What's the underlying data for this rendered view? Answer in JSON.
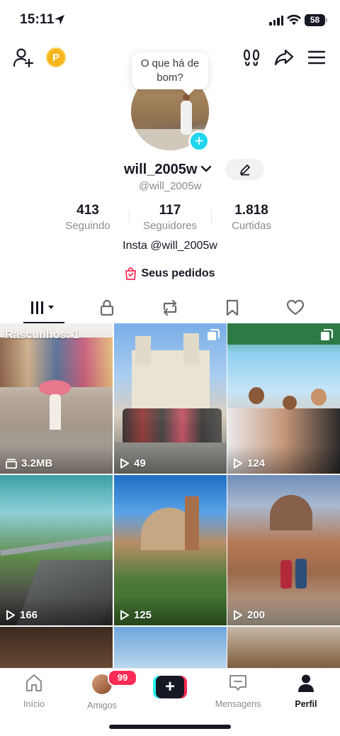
{
  "status_bar": {
    "time": "15:11",
    "battery": "58"
  },
  "profile": {
    "tooltip": "O que há de bom?",
    "username": "will_2005w",
    "handle": "@will_2005w",
    "bio": "Insta @will_2005w",
    "orders_label": "Seus pedidos",
    "coin_letter": "P"
  },
  "stats": [
    {
      "value": "413",
      "label": "Seguindo"
    },
    {
      "value": "117",
      "label": "Seguidores"
    },
    {
      "value": "1.818",
      "label": "Curtidas"
    }
  ],
  "tabs": [
    "videos-tab",
    "private-tab",
    "reposts-tab",
    "saved-tab",
    "liked-tab"
  ],
  "grid": {
    "draft_label": "Rascunhos: 1",
    "tiles": [
      {
        "count": "3.2MB",
        "kind": "draft"
      },
      {
        "count": "49",
        "kind": "video",
        "multi": true
      },
      {
        "count": "124",
        "kind": "video",
        "multi": true
      },
      {
        "count": "166",
        "kind": "video"
      },
      {
        "count": "125",
        "kind": "video"
      },
      {
        "count": "200",
        "kind": "video"
      }
    ]
  },
  "bottom_nav": {
    "items": [
      {
        "label": "Início"
      },
      {
        "label": "Amigos"
      },
      {
        "label": "+"
      },
      {
        "label": "Mensagens"
      },
      {
        "label": "Perfil"
      }
    ],
    "friends_badge": "99"
  },
  "colors": {
    "accent_red": "#fe2c55",
    "accent_cyan": "#20d5ec",
    "text": "#161823",
    "muted": "#8a8b91"
  }
}
